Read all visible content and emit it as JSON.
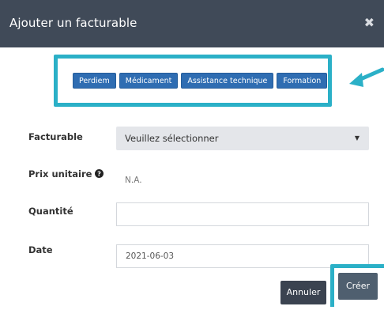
{
  "dialog": {
    "title": "Ajouter un facturable",
    "close_icon": "close-icon"
  },
  "shortcuts": [
    "Perdiem",
    "Médicament",
    "Assistance technique",
    "Formation"
  ],
  "form": {
    "facturable_label": "Facturable",
    "facturable_value": "Veuillez sélectionner",
    "prix_label": "Prix unitaire",
    "prix_value": "N.A.",
    "quantite_label": "Quantité",
    "quantite_value": "",
    "date_label": "Date",
    "date_value": "2021-06-03"
  },
  "buttons": {
    "cancel": "Annuler",
    "create": "Créer"
  },
  "colors": {
    "header": "#404a58",
    "chip": "#2f6db2",
    "highlight": "#2bb0c7"
  }
}
